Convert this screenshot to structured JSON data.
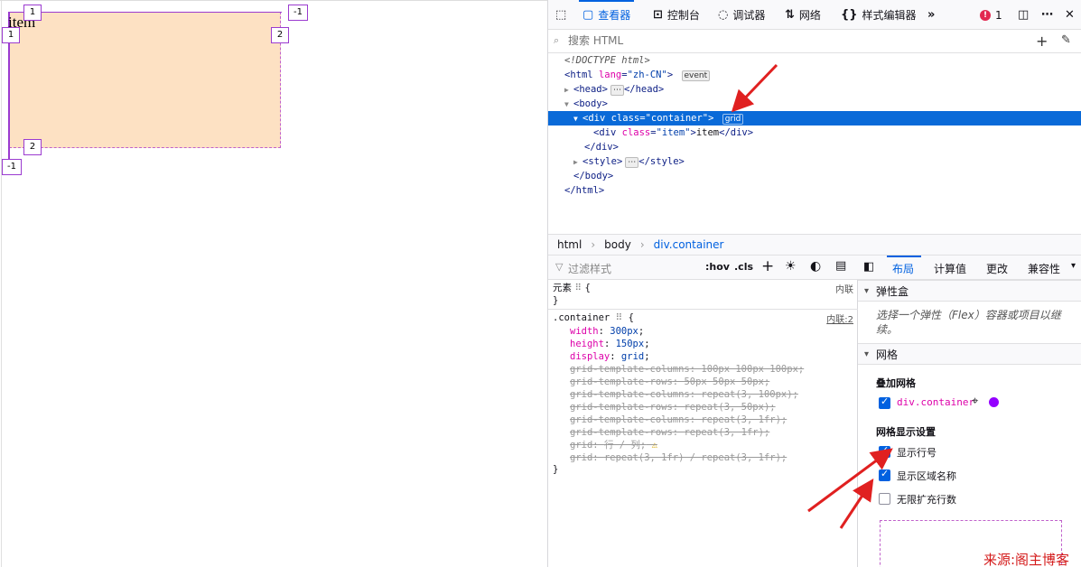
{
  "viewport": {
    "item_text": "item",
    "grid_line_labels": {
      "top_col1": "1",
      "top_col_neg": "-1",
      "left_row1": "1",
      "right_row2": "2",
      "bottom_col2": "2",
      "left_row_neg": "-1"
    }
  },
  "toolbar": {
    "tabs": [
      "查看器",
      "控制台",
      "调试器",
      "网络",
      "样式编辑器"
    ],
    "error_count": "1"
  },
  "search": {
    "placeholder": "搜索 HTML"
  },
  "html_tree": {
    "doctype": "<!DOCTYPE html>",
    "html_open_tag": "html",
    "html_attr": "lang",
    "html_attr_val": "\"zh-CN\"",
    "event_badge": "event",
    "head": "head",
    "body": "body",
    "container_tag": "div",
    "container_attr": "class",
    "container_val": "\"container\"",
    "grid_badge": "grid",
    "item_tag": "div",
    "item_attr": "class",
    "item_val": "\"item\"",
    "item_text": "item",
    "div_close": "</div>",
    "style": "style",
    "body_close": "</body>",
    "html_close": "</html>"
  },
  "breadcrumbs": [
    "html",
    "body",
    "div.container"
  ],
  "rules": {
    "filter_placeholder": "过滤样式",
    "hov": ":hov",
    "cls": ".cls",
    "element_label": "元素",
    "element_source": "内联",
    "container_selector": ".container",
    "container_source": "内联:2",
    "declarations": [
      {
        "prop": "width",
        "val": "300px",
        "struck": false
      },
      {
        "prop": "height",
        "val": "150px",
        "struck": false
      },
      {
        "prop": "display",
        "val": "grid",
        "struck": false
      },
      {
        "prop": "grid-template-columns",
        "val": "100px 100px 100px",
        "struck": true
      },
      {
        "prop": "grid-template-rows",
        "val": "50px 50px 50px",
        "struck": true
      },
      {
        "prop": "grid-template-columns",
        "val": "repeat(3, 100px)",
        "struck": true
      },
      {
        "prop": "grid-template-rows",
        "val": "repeat(3, 50px)",
        "struck": true
      },
      {
        "prop": "grid-template-columns",
        "val": "repeat(3, 1fr)",
        "struck": true
      },
      {
        "prop": "grid-template-rows",
        "val": "repeat(3, 1fr)",
        "struck": true
      },
      {
        "prop": "grid",
        "val": "行 / 列",
        "struck": true
      },
      {
        "prop": "grid",
        "val": "repeat(3, 1fr) / repeat(3, 1fr)",
        "struck": true
      }
    ]
  },
  "side_tabs": [
    "布局",
    "计算值",
    "更改",
    "兼容性"
  ],
  "layout": {
    "flex_title": "弹性盒",
    "flex_hint": "选择一个弹性（Flex）容器或项目以继续。",
    "grid_title": "网格",
    "overlay_title": "叠加网格",
    "overlay_item": "div.container",
    "overlay_color": "#9400ff",
    "display_settings_title": "网格显示设置",
    "options": [
      {
        "label": "显示行号",
        "checked": true
      },
      {
        "label": "显示区域名称",
        "checked": true
      },
      {
        "label": "无限扩充行数",
        "checked": false
      }
    ]
  },
  "watermark": "来源:阁主博客",
  "colors": {
    "accent": "#0061e0",
    "grid_overlay": "#9b3bd0",
    "grid_fill": "#fde1c3",
    "arrow": "#e02020"
  }
}
